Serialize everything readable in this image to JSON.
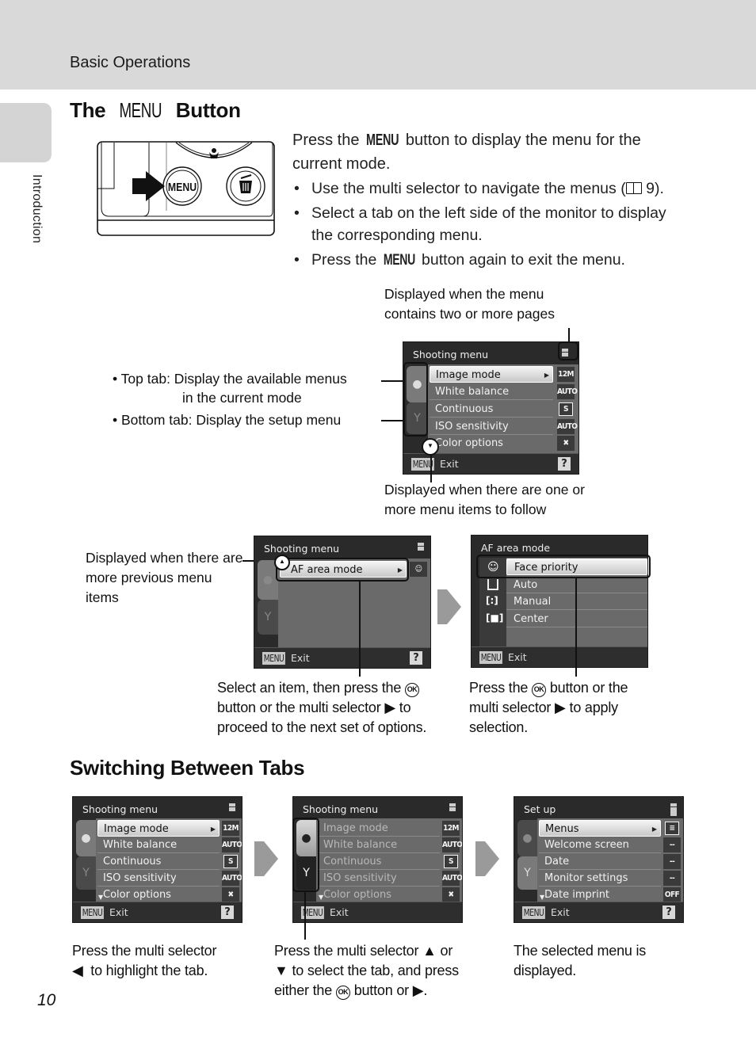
{
  "header": {
    "section_title": "Basic Operations"
  },
  "side_tab": {
    "label": "Introduction"
  },
  "page_number": "10",
  "section1": {
    "title_prefix": "The",
    "title_menu": "MENU",
    "title_suffix": "Button",
    "camera_illustration": {
      "menu_button_label": "MENU",
      "icons": [
        "macro-tulip-icon",
        "trash-icon",
        "arrow-pointer-icon"
      ]
    },
    "intro_line1_prefix": "Press the",
    "intro_line1_menu": "MENU",
    "intro_line1_suffix": "button to display the menu for the current mode.",
    "bullets": [
      {
        "prefix": "Use the multi selector to navigate the menus (",
        "ref_icon": "book-icon",
        "suffix": " 9)."
      },
      {
        "prefix": "Select a tab on the left side of the monitor to display the corresponding menu."
      },
      {
        "prefix": "Press the ",
        "menu": "MENU",
        "suffix": " button again to exit the menu."
      }
    ],
    "annotations": {
      "pages": "Displayed when the menu contains two or more pages",
      "top_tab": "• Top tab: Display the available menus",
      "top_tab_cont": "in the current mode",
      "bottom_tab": "• Bottom tab: Display the setup menu",
      "follow": "Displayed when there are one or more menu items to follow",
      "previous": "Displayed when there are more previous menu items",
      "select_item": "Select an item, then press the",
      "select_item_2": "button or the multi selector",
      "select_item_3": "to",
      "select_item_4": "proceed to the next set of options.",
      "apply_1": "Press the",
      "apply_2": "button or the",
      "apply_3": "multi selector",
      "apply_4": "to apply",
      "apply_5": "selection."
    },
    "ok_symbol": "OK",
    "main_screen": {
      "title": "Shooting menu",
      "items": [
        {
          "label": "Image mode",
          "value": "12M",
          "selected": true
        },
        {
          "label": "White balance",
          "value": "AUTO"
        },
        {
          "label": "Continuous",
          "value": "S"
        },
        {
          "label": "ISO sensitivity",
          "value": "AUTO"
        },
        {
          "label": "Color options",
          "value": "color-off-icon"
        }
      ],
      "footer_menu": "MENU",
      "footer_exit": "Exit",
      "help": "?"
    },
    "af_screen": {
      "title": "Shooting menu",
      "item": "AF area mode",
      "value_icon": "face-priority-icon",
      "footer_menu": "MENU",
      "footer_exit": "Exit",
      "help": "?"
    },
    "af_options_screen": {
      "title": "AF area mode",
      "options": [
        {
          "label": "Face priority",
          "icon": "face-priority-icon",
          "selected": true
        },
        {
          "label": "Auto",
          "icon": "auto-area-icon"
        },
        {
          "label": "Manual",
          "icon": "manual-area-icon"
        },
        {
          "label": "Center",
          "icon": "center-area-icon"
        }
      ],
      "footer_menu": "MENU",
      "footer_exit": "Exit"
    }
  },
  "section2": {
    "title": "Switching Between Tabs",
    "screens": [
      {
        "title": "Shooting menu",
        "items": [
          {
            "label": "Image mode",
            "value": "12M",
            "selected": true
          },
          {
            "label": "White balance",
            "value": "AUTO"
          },
          {
            "label": "Continuous",
            "value": "S"
          },
          {
            "label": "ISO sensitivity",
            "value": "AUTO"
          },
          {
            "label": "Color options",
            "value": "color-off-icon"
          }
        ],
        "footer_menu": "MENU",
        "footer_exit": "Exit",
        "help": "?"
      },
      {
        "title": "Shooting menu",
        "items": [
          {
            "label": "Image mode",
            "value": "12M"
          },
          {
            "label": "White balance",
            "value": "AUTO"
          },
          {
            "label": "Continuous",
            "value": "S"
          },
          {
            "label": "ISO sensitivity",
            "value": "AUTO"
          },
          {
            "label": "Color options",
            "value": "color-off-icon"
          }
        ],
        "footer_menu": "MENU",
        "footer_exit": "Exit"
      },
      {
        "title": "Set up",
        "items": [
          {
            "label": "Menus",
            "value": "list-icon",
            "selected": true
          },
          {
            "label": "Welcome screen",
            "value": "--"
          },
          {
            "label": "Date",
            "value": "--"
          },
          {
            "label": "Monitor settings",
            "value": "--"
          },
          {
            "label": "Date imprint",
            "value": "OFF"
          }
        ],
        "footer_menu": "MENU",
        "footer_exit": "Exit",
        "help": "?"
      }
    ],
    "captions": [
      {
        "line1": "Press the multi selector",
        "line2": "to highlight the tab."
      },
      {
        "line1": "Press the multi selector",
        "line1b": "or",
        "line2": "to select the tab, and press",
        "line3a": "either the",
        "line3b": "button or"
      },
      {
        "line1": "The selected menu is",
        "line2": "displayed."
      }
    ]
  }
}
